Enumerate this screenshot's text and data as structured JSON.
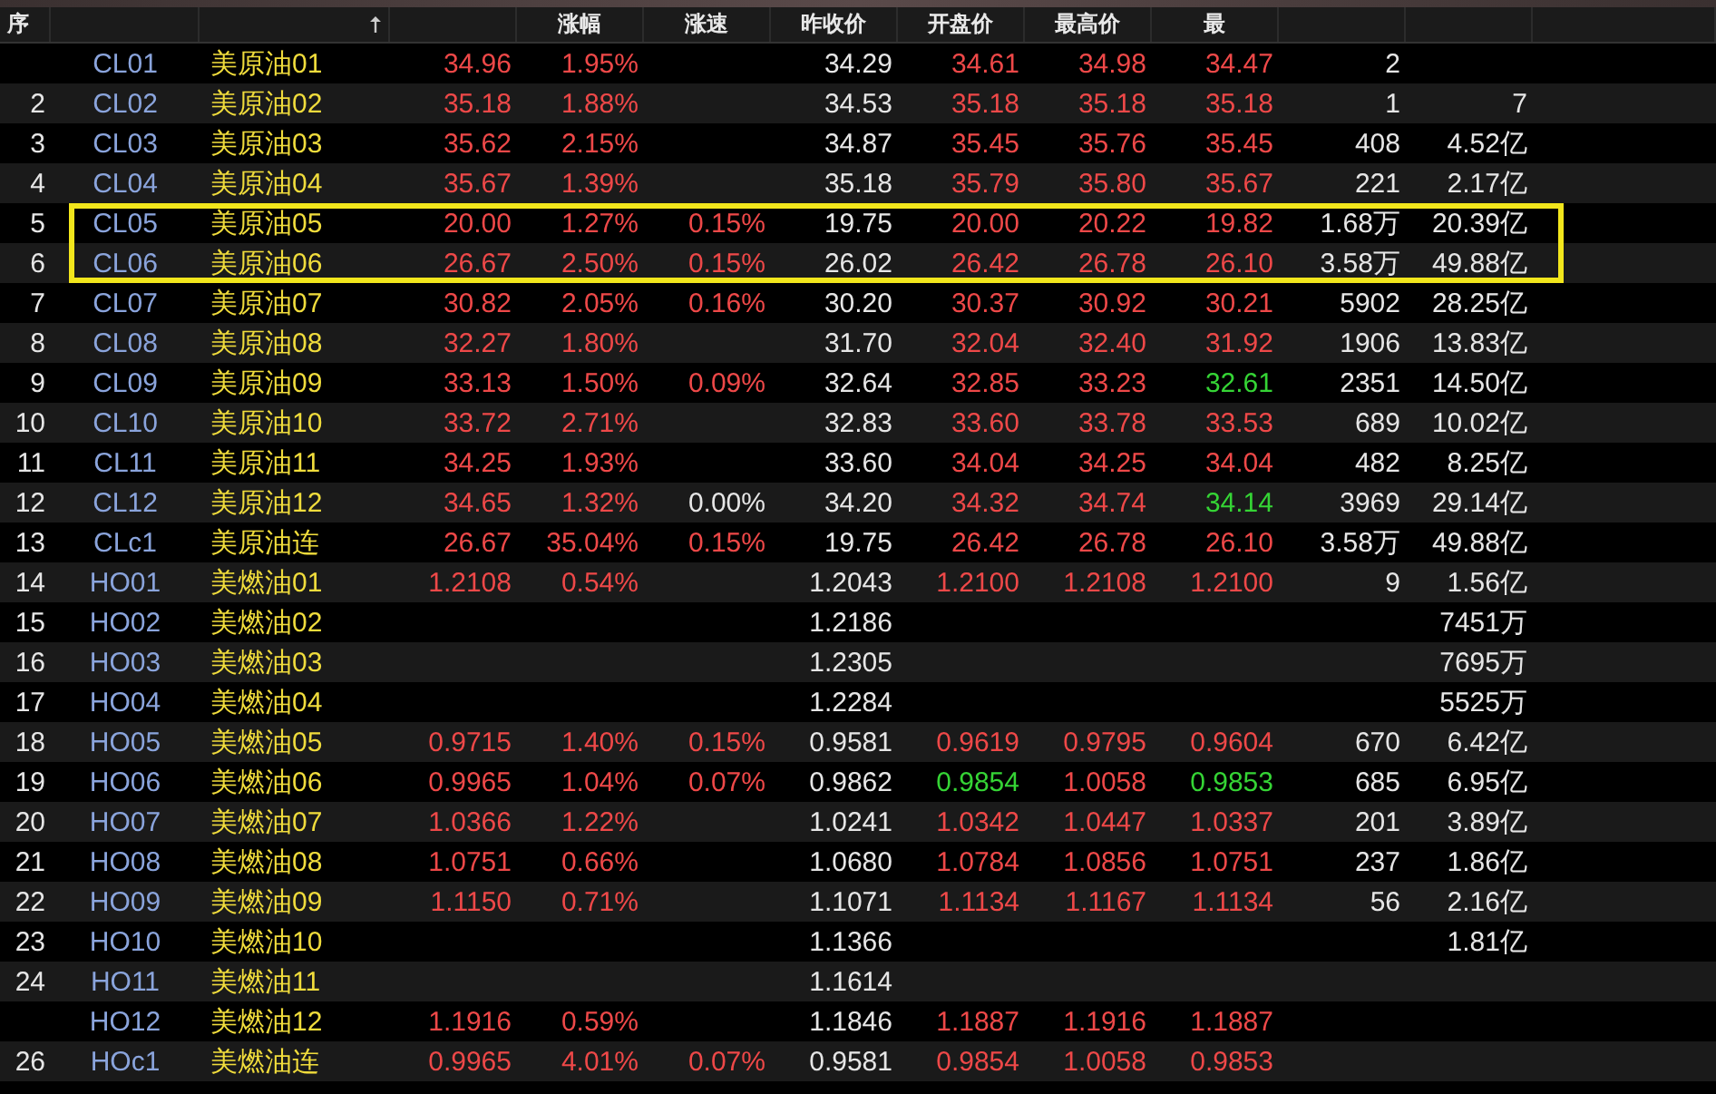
{
  "columns": [
    {
      "label": "序"
    },
    {},
    {
      "sort_mark": true
    },
    {},
    {
      "label": "涨幅"
    },
    {
      "label": "涨速"
    },
    {
      "label": "昨收价"
    },
    {
      "label": "开盘价"
    },
    {
      "label": "最高价"
    },
    {
      "label": "最"
    },
    {},
    {},
    {}
  ],
  "rows": [
    {
      "code": "CL01",
      "name": "美原油01",
      "highlighted": false,
      "cells": [
        {
          "text": "34.96",
          "color": "#ee4848"
        },
        {
          "text": "1.95%",
          "color": "#ee4848"
        },
        null,
        {
          "text": "34.29",
          "color": "#e6e6e6"
        },
        {
          "text": "34.61",
          "color": "#ee4848"
        },
        {
          "text": "34.98",
          "color": "#ee4848"
        },
        {
          "text": "34.47",
          "color": "#ee4848"
        },
        {
          "text": "2",
          "color": "#e6e6e6"
        },
        null
      ]
    },
    {
      "index": "2",
      "code": "CL02",
      "name": "美原油02",
      "highlighted": false,
      "cells": [
        {
          "text": "35.18",
          "color": "#ee4848"
        },
        {
          "text": "1.88%",
          "color": "#ee4848"
        },
        null,
        {
          "text": "34.53",
          "color": "#e6e6e6"
        },
        {
          "text": "35.18",
          "color": "#ee4848"
        },
        {
          "text": "35.18",
          "color": "#ee4848"
        },
        {
          "text": "35.18",
          "color": "#ee4848"
        },
        {
          "text": "1",
          "color": "#e6e6e6"
        },
        {
          "text": "7",
          "color": "#e6e6e6"
        }
      ]
    },
    {
      "index": "3",
      "code": "CL03",
      "name": "美原油03",
      "highlighted": false,
      "cells": [
        {
          "text": "35.62",
          "color": "#ee4848"
        },
        {
          "text": "2.15%",
          "color": "#ee4848"
        },
        null,
        {
          "text": "34.87",
          "color": "#e6e6e6"
        },
        {
          "text": "35.45",
          "color": "#ee4848"
        },
        {
          "text": "35.76",
          "color": "#ee4848"
        },
        {
          "text": "35.45",
          "color": "#ee4848"
        },
        {
          "text": "408",
          "color": "#e6e6e6"
        },
        {
          "text": "4.52亿",
          "color": "#e6e6e6"
        }
      ]
    },
    {
      "index": "4",
      "code": "CL04",
      "name": "美原油04",
      "highlighted": false,
      "cells": [
        {
          "text": "35.67",
          "color": "#ee4848"
        },
        {
          "text": "1.39%",
          "color": "#ee4848"
        },
        null,
        {
          "text": "35.18",
          "color": "#e6e6e6"
        },
        {
          "text": "35.79",
          "color": "#ee4848"
        },
        {
          "text": "35.80",
          "color": "#ee4848"
        },
        {
          "text": "35.67",
          "color": "#ee4848"
        },
        {
          "text": "221",
          "color": "#e6e6e6"
        },
        {
          "text": "2.17亿",
          "color": "#e6e6e6"
        }
      ]
    },
    {
      "index": "5",
      "code": "CL05",
      "name": "美原油05",
      "highlighted": true,
      "cells": [
        {
          "text": "20.00",
          "color": "#ee4848"
        },
        {
          "text": "1.27%",
          "color": "#ee4848"
        },
        {
          "text": "0.15%",
          "color": "#ee4848"
        },
        {
          "text": "19.75",
          "color": "#e6e6e6"
        },
        {
          "text": "20.00",
          "color": "#ee4848"
        },
        {
          "text": "20.22",
          "color": "#ee4848"
        },
        {
          "text": "19.82",
          "color": "#ee4848"
        },
        {
          "text": "1.68万",
          "color": "#e6e6e6"
        },
        {
          "text": "20.39亿",
          "color": "#e6e6e6"
        }
      ]
    },
    {
      "index": "6",
      "code": "CL06",
      "name": "美原油06",
      "highlighted": true,
      "cells": [
        {
          "text": "26.67",
          "color": "#ee4848"
        },
        {
          "text": "2.50%",
          "color": "#ee4848"
        },
        {
          "text": "0.15%",
          "color": "#ee4848"
        },
        {
          "text": "26.02",
          "color": "#e6e6e6"
        },
        {
          "text": "26.42",
          "color": "#ee4848"
        },
        {
          "text": "26.78",
          "color": "#ee4848"
        },
        {
          "text": "26.10",
          "color": "#ee4848"
        },
        {
          "text": "3.58万",
          "color": "#e6e6e6"
        },
        {
          "text": "49.88亿",
          "color": "#e6e6e6"
        }
      ]
    },
    {
      "index": "7",
      "code": "CL07",
      "name": "美原油07",
      "highlighted": false,
      "cells": [
        {
          "text": "30.82",
          "color": "#ee4848"
        },
        {
          "text": "2.05%",
          "color": "#ee4848"
        },
        {
          "text": "0.16%",
          "color": "#ee4848"
        },
        {
          "text": "30.20",
          "color": "#e6e6e6"
        },
        {
          "text": "30.37",
          "color": "#ee4848"
        },
        {
          "text": "30.92",
          "color": "#ee4848"
        },
        {
          "text": "30.21",
          "color": "#ee4848"
        },
        {
          "text": "5902",
          "color": "#e6e6e6"
        },
        {
          "text": "28.25亿",
          "color": "#e6e6e6"
        }
      ]
    },
    {
      "index": "8",
      "code": "CL08",
      "name": "美原油08",
      "highlighted": false,
      "cells": [
        {
          "text": "32.27",
          "color": "#ee4848"
        },
        {
          "text": "1.80%",
          "color": "#ee4848"
        },
        null,
        {
          "text": "31.70",
          "color": "#e6e6e6"
        },
        {
          "text": "32.04",
          "color": "#ee4848"
        },
        {
          "text": "32.40",
          "color": "#ee4848"
        },
        {
          "text": "31.92",
          "color": "#ee4848"
        },
        {
          "text": "1906",
          "color": "#e6e6e6"
        },
        {
          "text": "13.83亿",
          "color": "#e6e6e6"
        }
      ]
    },
    {
      "index": "9",
      "code": "CL09",
      "name": "美原油09",
      "highlighted": false,
      "cells": [
        {
          "text": "33.13",
          "color": "#ee4848"
        },
        {
          "text": "1.50%",
          "color": "#ee4848"
        },
        {
          "text": "0.09%",
          "color": "#ee4848"
        },
        {
          "text": "32.64",
          "color": "#e6e6e6"
        },
        {
          "text": "32.85",
          "color": "#ee4848"
        },
        {
          "text": "33.23",
          "color": "#ee4848"
        },
        {
          "text": "32.61",
          "color": "#35d435"
        },
        {
          "text": "2351",
          "color": "#e6e6e6"
        },
        {
          "text": "14.50亿",
          "color": "#e6e6e6"
        }
      ]
    },
    {
      "index": "10",
      "code": "CL10",
      "name": "美原油10",
      "highlighted": false,
      "cells": [
        {
          "text": "33.72",
          "color": "#ee4848"
        },
        {
          "text": "2.71%",
          "color": "#ee4848"
        },
        null,
        {
          "text": "32.83",
          "color": "#e6e6e6"
        },
        {
          "text": "33.60",
          "color": "#ee4848"
        },
        {
          "text": "33.78",
          "color": "#ee4848"
        },
        {
          "text": "33.53",
          "color": "#ee4848"
        },
        {
          "text": "689",
          "color": "#e6e6e6"
        },
        {
          "text": "10.02亿",
          "color": "#e6e6e6"
        }
      ]
    },
    {
      "index": "11",
      "code": "CL11",
      "name": "美原油11",
      "highlighted": false,
      "cells": [
        {
          "text": "34.25",
          "color": "#ee4848"
        },
        {
          "text": "1.93%",
          "color": "#ee4848"
        },
        null,
        {
          "text": "33.60",
          "color": "#e6e6e6"
        },
        {
          "text": "34.04",
          "color": "#ee4848"
        },
        {
          "text": "34.25",
          "color": "#ee4848"
        },
        {
          "text": "34.04",
          "color": "#ee4848"
        },
        {
          "text": "482",
          "color": "#e6e6e6"
        },
        {
          "text": "8.25亿",
          "color": "#e6e6e6"
        }
      ]
    },
    {
      "index": "12",
      "code": "CL12",
      "name": "美原油12",
      "highlighted": false,
      "cells": [
        {
          "text": "34.65",
          "color": "#ee4848"
        },
        {
          "text": "1.32%",
          "color": "#ee4848"
        },
        {
          "text": "0.00%",
          "color": "#e6e6e6"
        },
        {
          "text": "34.20",
          "color": "#e6e6e6"
        },
        {
          "text": "34.32",
          "color": "#ee4848"
        },
        {
          "text": "34.74",
          "color": "#ee4848"
        },
        {
          "text": "34.14",
          "color": "#35d435"
        },
        {
          "text": "3969",
          "color": "#e6e6e6"
        },
        {
          "text": "29.14亿",
          "color": "#e6e6e6"
        }
      ]
    },
    {
      "index": "13",
      "code": "CLc1",
      "name": "美原油连",
      "highlighted": false,
      "cells": [
        {
          "text": "26.67",
          "color": "#ee4848"
        },
        {
          "text": "35.04%",
          "color": "#ee4848"
        },
        {
          "text": "0.15%",
          "color": "#ee4848"
        },
        {
          "text": "19.75",
          "color": "#e6e6e6"
        },
        {
          "text": "26.42",
          "color": "#ee4848"
        },
        {
          "text": "26.78",
          "color": "#ee4848"
        },
        {
          "text": "26.10",
          "color": "#ee4848"
        },
        {
          "text": "3.58万",
          "color": "#e6e6e6"
        },
        {
          "text": "49.88亿",
          "color": "#e6e6e6"
        }
      ]
    },
    {
      "index": "14",
      "code": "HO01",
      "name": "美燃油01",
      "highlighted": false,
      "cells": [
        {
          "text": "1.2108",
          "color": "#ee4848"
        },
        {
          "text": "0.54%",
          "color": "#ee4848"
        },
        null,
        {
          "text": "1.2043",
          "color": "#e6e6e6"
        },
        {
          "text": "1.2100",
          "color": "#ee4848"
        },
        {
          "text": "1.2108",
          "color": "#ee4848"
        },
        {
          "text": "1.2100",
          "color": "#ee4848"
        },
        {
          "text": "9",
          "color": "#e6e6e6"
        },
        {
          "text": "1.56亿",
          "color": "#e6e6e6"
        }
      ]
    },
    {
      "index": "15",
      "code": "HO02",
      "name": "美燃油02",
      "highlighted": false,
      "cells": [
        null,
        null,
        null,
        {
          "text": "1.2186",
          "color": "#e6e6e6"
        },
        null,
        null,
        null,
        null,
        {
          "text": "7451万",
          "color": "#e6e6e6"
        }
      ]
    },
    {
      "index": "16",
      "code": "HO03",
      "name": "美燃油03",
      "highlighted": false,
      "cells": [
        null,
        null,
        null,
        {
          "text": "1.2305",
          "color": "#e6e6e6"
        },
        null,
        null,
        null,
        null,
        {
          "text": "7695万",
          "color": "#e6e6e6"
        }
      ]
    },
    {
      "index": "17",
      "code": "HO04",
      "name": "美燃油04",
      "highlighted": false,
      "cells": [
        null,
        null,
        null,
        {
          "text": "1.2284",
          "color": "#e6e6e6"
        },
        null,
        null,
        null,
        null,
        {
          "text": "5525万",
          "color": "#e6e6e6"
        }
      ]
    },
    {
      "index": "18",
      "code": "HO05",
      "name": "美燃油05",
      "highlighted": false,
      "cells": [
        {
          "text": "0.9715",
          "color": "#ee4848"
        },
        {
          "text": "1.40%",
          "color": "#ee4848"
        },
        {
          "text": "0.15%",
          "color": "#ee4848"
        },
        {
          "text": "0.9581",
          "color": "#e6e6e6"
        },
        {
          "text": "0.9619",
          "color": "#ee4848"
        },
        {
          "text": "0.9795",
          "color": "#ee4848"
        },
        {
          "text": "0.9604",
          "color": "#ee4848"
        },
        {
          "text": "670",
          "color": "#e6e6e6"
        },
        {
          "text": "6.42亿",
          "color": "#e6e6e6"
        }
      ]
    },
    {
      "index": "19",
      "code": "HO06",
      "name": "美燃油06",
      "highlighted": false,
      "cells": [
        {
          "text": "0.9965",
          "color": "#ee4848"
        },
        {
          "text": "1.04%",
          "color": "#ee4848"
        },
        {
          "text": "0.07%",
          "color": "#ee4848"
        },
        {
          "text": "0.9862",
          "color": "#e6e6e6"
        },
        {
          "text": "0.9854",
          "color": "#35d435"
        },
        {
          "text": "1.0058",
          "color": "#ee4848"
        },
        {
          "text": "0.9853",
          "color": "#35d435"
        },
        {
          "text": "685",
          "color": "#e6e6e6"
        },
        {
          "text": "6.95亿",
          "color": "#e6e6e6"
        }
      ]
    },
    {
      "index": "20",
      "code": "HO07",
      "name": "美燃油07",
      "highlighted": false,
      "cells": [
        {
          "text": "1.0366",
          "color": "#ee4848"
        },
        {
          "text": "1.22%",
          "color": "#ee4848"
        },
        null,
        {
          "text": "1.0241",
          "color": "#e6e6e6"
        },
        {
          "text": "1.0342",
          "color": "#ee4848"
        },
        {
          "text": "1.0447",
          "color": "#ee4848"
        },
        {
          "text": "1.0337",
          "color": "#ee4848"
        },
        {
          "text": "201",
          "color": "#e6e6e6"
        },
        {
          "text": "3.89亿",
          "color": "#e6e6e6"
        }
      ]
    },
    {
      "index": "21",
      "code": "HO08",
      "name": "美燃油08",
      "highlighted": false,
      "cells": [
        {
          "text": "1.0751",
          "color": "#ee4848"
        },
        {
          "text": "0.66%",
          "color": "#ee4848"
        },
        null,
        {
          "text": "1.0680",
          "color": "#e6e6e6"
        },
        {
          "text": "1.0784",
          "color": "#ee4848"
        },
        {
          "text": "1.0856",
          "color": "#ee4848"
        },
        {
          "text": "1.0751",
          "color": "#ee4848"
        },
        {
          "text": "237",
          "color": "#e6e6e6"
        },
        {
          "text": "1.86亿",
          "color": "#e6e6e6"
        }
      ]
    },
    {
      "index": "22",
      "code": "HO09",
      "name": "美燃油09",
      "highlighted": false,
      "cells": [
        {
          "text": "1.1150",
          "color": "#ee4848"
        },
        {
          "text": "0.71%",
          "color": "#ee4848"
        },
        null,
        {
          "text": "1.1071",
          "color": "#e6e6e6"
        },
        {
          "text": "1.1134",
          "color": "#ee4848"
        },
        {
          "text": "1.1167",
          "color": "#ee4848"
        },
        {
          "text": "1.1134",
          "color": "#ee4848"
        },
        {
          "text": "56",
          "color": "#e6e6e6"
        },
        {
          "text": "2.16亿",
          "color": "#e6e6e6"
        }
      ]
    },
    {
      "index": "23",
      "code": "HO10",
      "name": "美燃油10",
      "highlighted": false,
      "cells": [
        null,
        null,
        null,
        {
          "text": "1.1366",
          "color": "#e6e6e6"
        },
        null,
        null,
        null,
        null,
        {
          "text": "1.81亿",
          "color": "#e6e6e6"
        }
      ]
    },
    {
      "index": "24",
      "code": "HO11",
      "name": "美燃油11",
      "highlighted": false,
      "cells": [
        null,
        null,
        null,
        {
          "text": "1.1614",
          "color": "#e6e6e6"
        },
        null,
        null,
        null,
        null,
        null
      ]
    },
    {
      "code": "HO12",
      "name": "美燃油12",
      "highlighted": false,
      "cells": [
        {
          "text": "1.1916",
          "color": "#ee4848"
        },
        {
          "text": "0.59%",
          "color": "#ee4848"
        },
        null,
        {
          "text": "1.1846",
          "color": "#e6e6e6"
        },
        {
          "text": "1.1887",
          "color": "#ee4848"
        },
        {
          "text": "1.1916",
          "color": "#ee4848"
        },
        {
          "text": "1.1887",
          "color": "#ee4848"
        },
        null,
        null
      ]
    },
    {
      "index": "26",
      "code": "HOc1",
      "name": "美燃油连",
      "highlighted": false,
      "cells": [
        {
          "text": "0.9965",
          "color": "#ee4848"
        },
        {
          "text": "4.01%",
          "color": "#ee4848"
        },
        {
          "text": "0.07%",
          "color": "#ee4848"
        },
        {
          "text": "0.9581",
          "color": "#e6e6e6"
        },
        {
          "text": "0.9854",
          "color": "#ee4848"
        },
        {
          "text": "1.0058",
          "color": "#ee4848"
        },
        {
          "text": "0.9853",
          "color": "#ee4848"
        },
        null,
        null
      ]
    }
  ]
}
